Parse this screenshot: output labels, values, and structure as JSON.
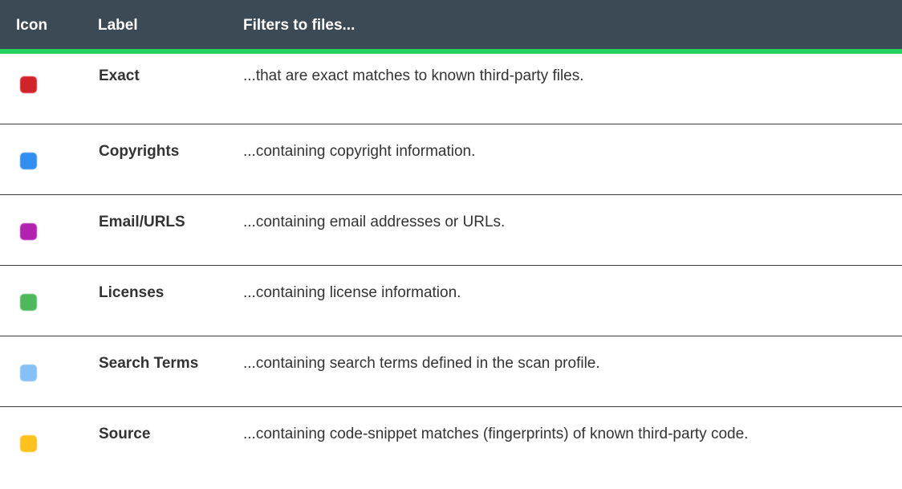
{
  "header": {
    "col_icon": "Icon",
    "col_label": "Label",
    "col_desc": "Filters to files..."
  },
  "rows": [
    {
      "label": "Exact",
      "description": "...that are exact matches to known third-party files.",
      "color": "#d2232a",
      "icon": "red-square-icon"
    },
    {
      "label": "Copyrights",
      "description": "...containing copyright information.",
      "color": "#2f8ef0",
      "icon": "blue-square-icon"
    },
    {
      "label": "Email/URLS",
      "description": "...containing email addresses or URLs.",
      "color": "#b321b1",
      "icon": "purple-square-icon"
    },
    {
      "label": "Licenses",
      "description": "...containing license information.",
      "color": "#4cba5c",
      "icon": "green-square-icon"
    },
    {
      "label": "Search Terms",
      "description": "...containing search terms defined in the scan profile.",
      "color": "#86c0f6",
      "icon": "light-blue-square-icon"
    },
    {
      "label": "Source",
      "description": "...containing code-snippet matches (fingerprints) of known third-party code.",
      "color": "#ffc21c",
      "icon": "yellow-square-icon"
    }
  ]
}
